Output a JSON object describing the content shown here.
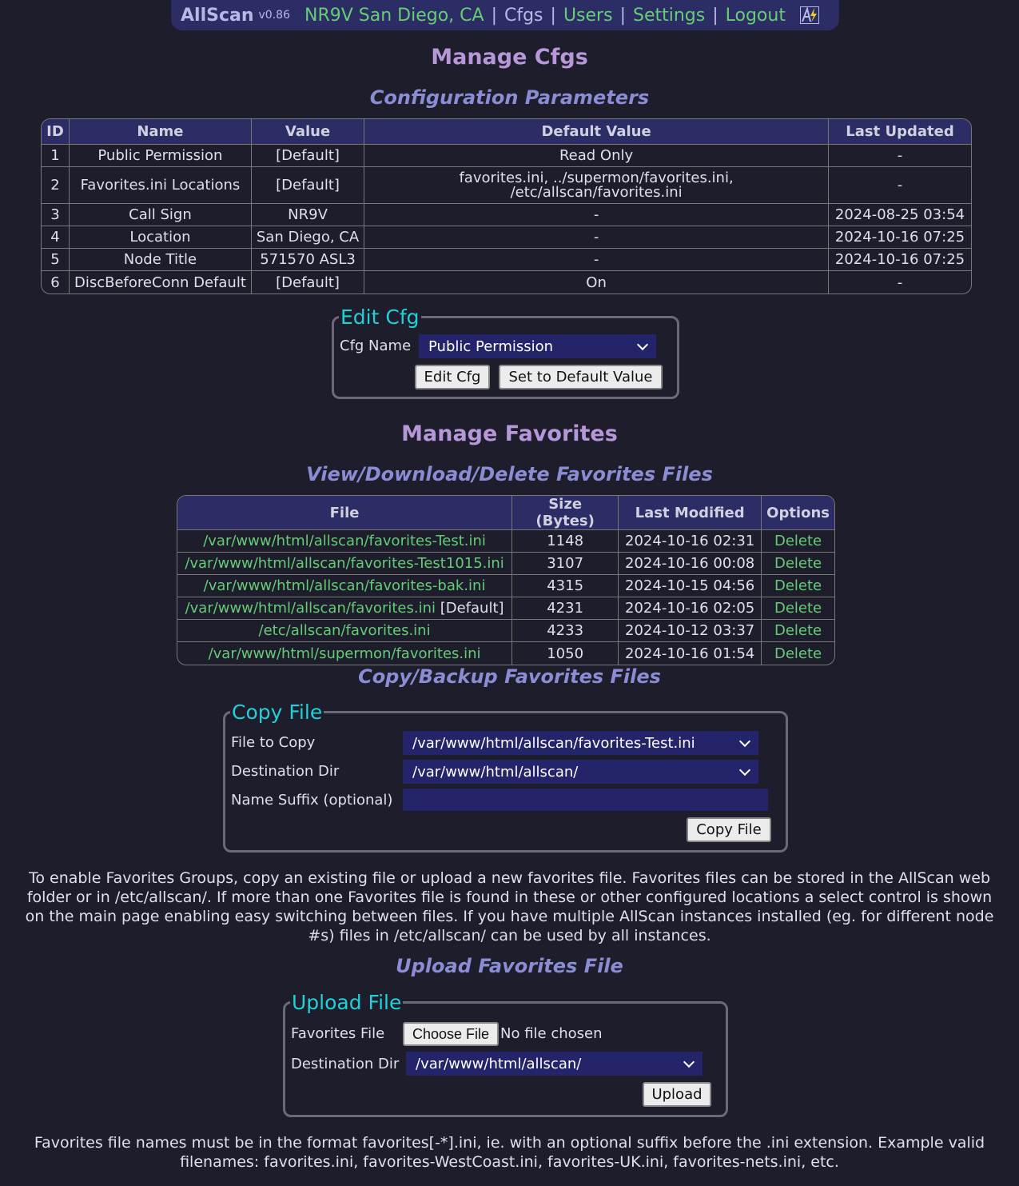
{
  "header": {
    "brand": "AllScan",
    "version": "v0.86",
    "node": "NR9V San Diego, CA",
    "nav": [
      "Cfgs",
      "Users",
      "Settings",
      "Logout"
    ]
  },
  "cfgs": {
    "title": "Manage Cfgs",
    "subtitle": "Configuration Parameters",
    "columns": [
      "ID",
      "Name",
      "Value",
      "Default Value",
      "Last Updated"
    ],
    "rows": [
      [
        "1",
        "Public Permission",
        "[Default]",
        "Read Only",
        "-"
      ],
      [
        "2",
        "Favorites.ini Locations",
        "[Default]",
        "favorites.ini, ../supermon/favorites.ini,\n/etc/allscan/favorites.ini",
        "-"
      ],
      [
        "3",
        "Call Sign",
        "NR9V",
        "-",
        "2024-08-25 03:54"
      ],
      [
        "4",
        "Location",
        "San Diego, CA",
        "-",
        "2024-10-16 07:25"
      ],
      [
        "5",
        "Node Title",
        "571570 ASL3",
        "-",
        "2024-10-16 07:25"
      ],
      [
        "6",
        "DiscBeforeConn Default",
        "[Default]",
        "On",
        "-"
      ]
    ]
  },
  "edit_cfg": {
    "legend": "Edit Cfg",
    "label": "Cfg Name",
    "selected": "Public Permission",
    "edit_button": "Edit Cfg",
    "default_button": "Set to Default Value"
  },
  "favorites": {
    "title": "Manage Favorites",
    "subtitle": "View/Download/Delete Favorites Files",
    "columns": [
      "File",
      "Size (Bytes)",
      "Last Modified",
      "Options"
    ],
    "rows": [
      {
        "file": "/var/www/html/allscan/favorites-Test.ini",
        "tag": "",
        "size": "1148",
        "modified": "2024-10-16 02:31",
        "option": "Delete"
      },
      {
        "file": "/var/www/html/allscan/favorites-Test1015.ini",
        "tag": "",
        "size": "3107",
        "modified": "2024-10-16 00:08",
        "option": "Delete"
      },
      {
        "file": "/var/www/html/allscan/favorites-bak.ini",
        "tag": "",
        "size": "4315",
        "modified": "2024-10-15 04:56",
        "option": "Delete"
      },
      {
        "file": "/var/www/html/allscan/favorites.ini",
        "tag": " [Default]",
        "size": "4231",
        "modified": "2024-10-16 02:05",
        "option": "Delete"
      },
      {
        "file": "/etc/allscan/favorites.ini",
        "tag": "",
        "size": "4233",
        "modified": "2024-10-12 03:37",
        "option": "Delete"
      },
      {
        "file": "/var/www/html/supermon/favorites.ini",
        "tag": "",
        "size": "1050",
        "modified": "2024-10-16 01:54",
        "option": "Delete"
      }
    ]
  },
  "copy": {
    "subtitle": "Copy/Backup Favorites Files",
    "legend": "Copy File",
    "file_label": "File to Copy",
    "file_value": "/var/www/html/allscan/favorites-Test.ini",
    "dest_label": "Destination Dir",
    "dest_value": "/var/www/html/allscan/",
    "suffix_label": "Name Suffix (optional)",
    "suffix_value": "",
    "button": "Copy File"
  },
  "info_text": "To enable Favorites Groups, copy an existing file or upload a new favorites file. Favorites files can be stored in the AllScan web folder or in /etc/allscan/. If more than one Favorites file is found in these or other configured locations a select control is shown on the main page enabling easy switching between files. If you have multiple AllScan instances installed (eg. for different node #s) files in /etc/allscan/ can be used by all instances.",
  "upload": {
    "subtitle": "Upload Favorites File",
    "legend": "Upload File",
    "file_label": "Favorites File",
    "choose_button": "Choose File",
    "no_file": "No file chosen",
    "dest_label": "Destination Dir",
    "dest_value": "/var/www/html/allscan/",
    "button": "Upload"
  },
  "footer_text": "Favorites file names must be in the format favorites[-*].ini, ie. with an optional suffix before the .ini extension. Example valid filenames: favorites.ini, favorites-WestCoast.ini, favorites-UK.ini, favorites-nets.ini, etc."
}
